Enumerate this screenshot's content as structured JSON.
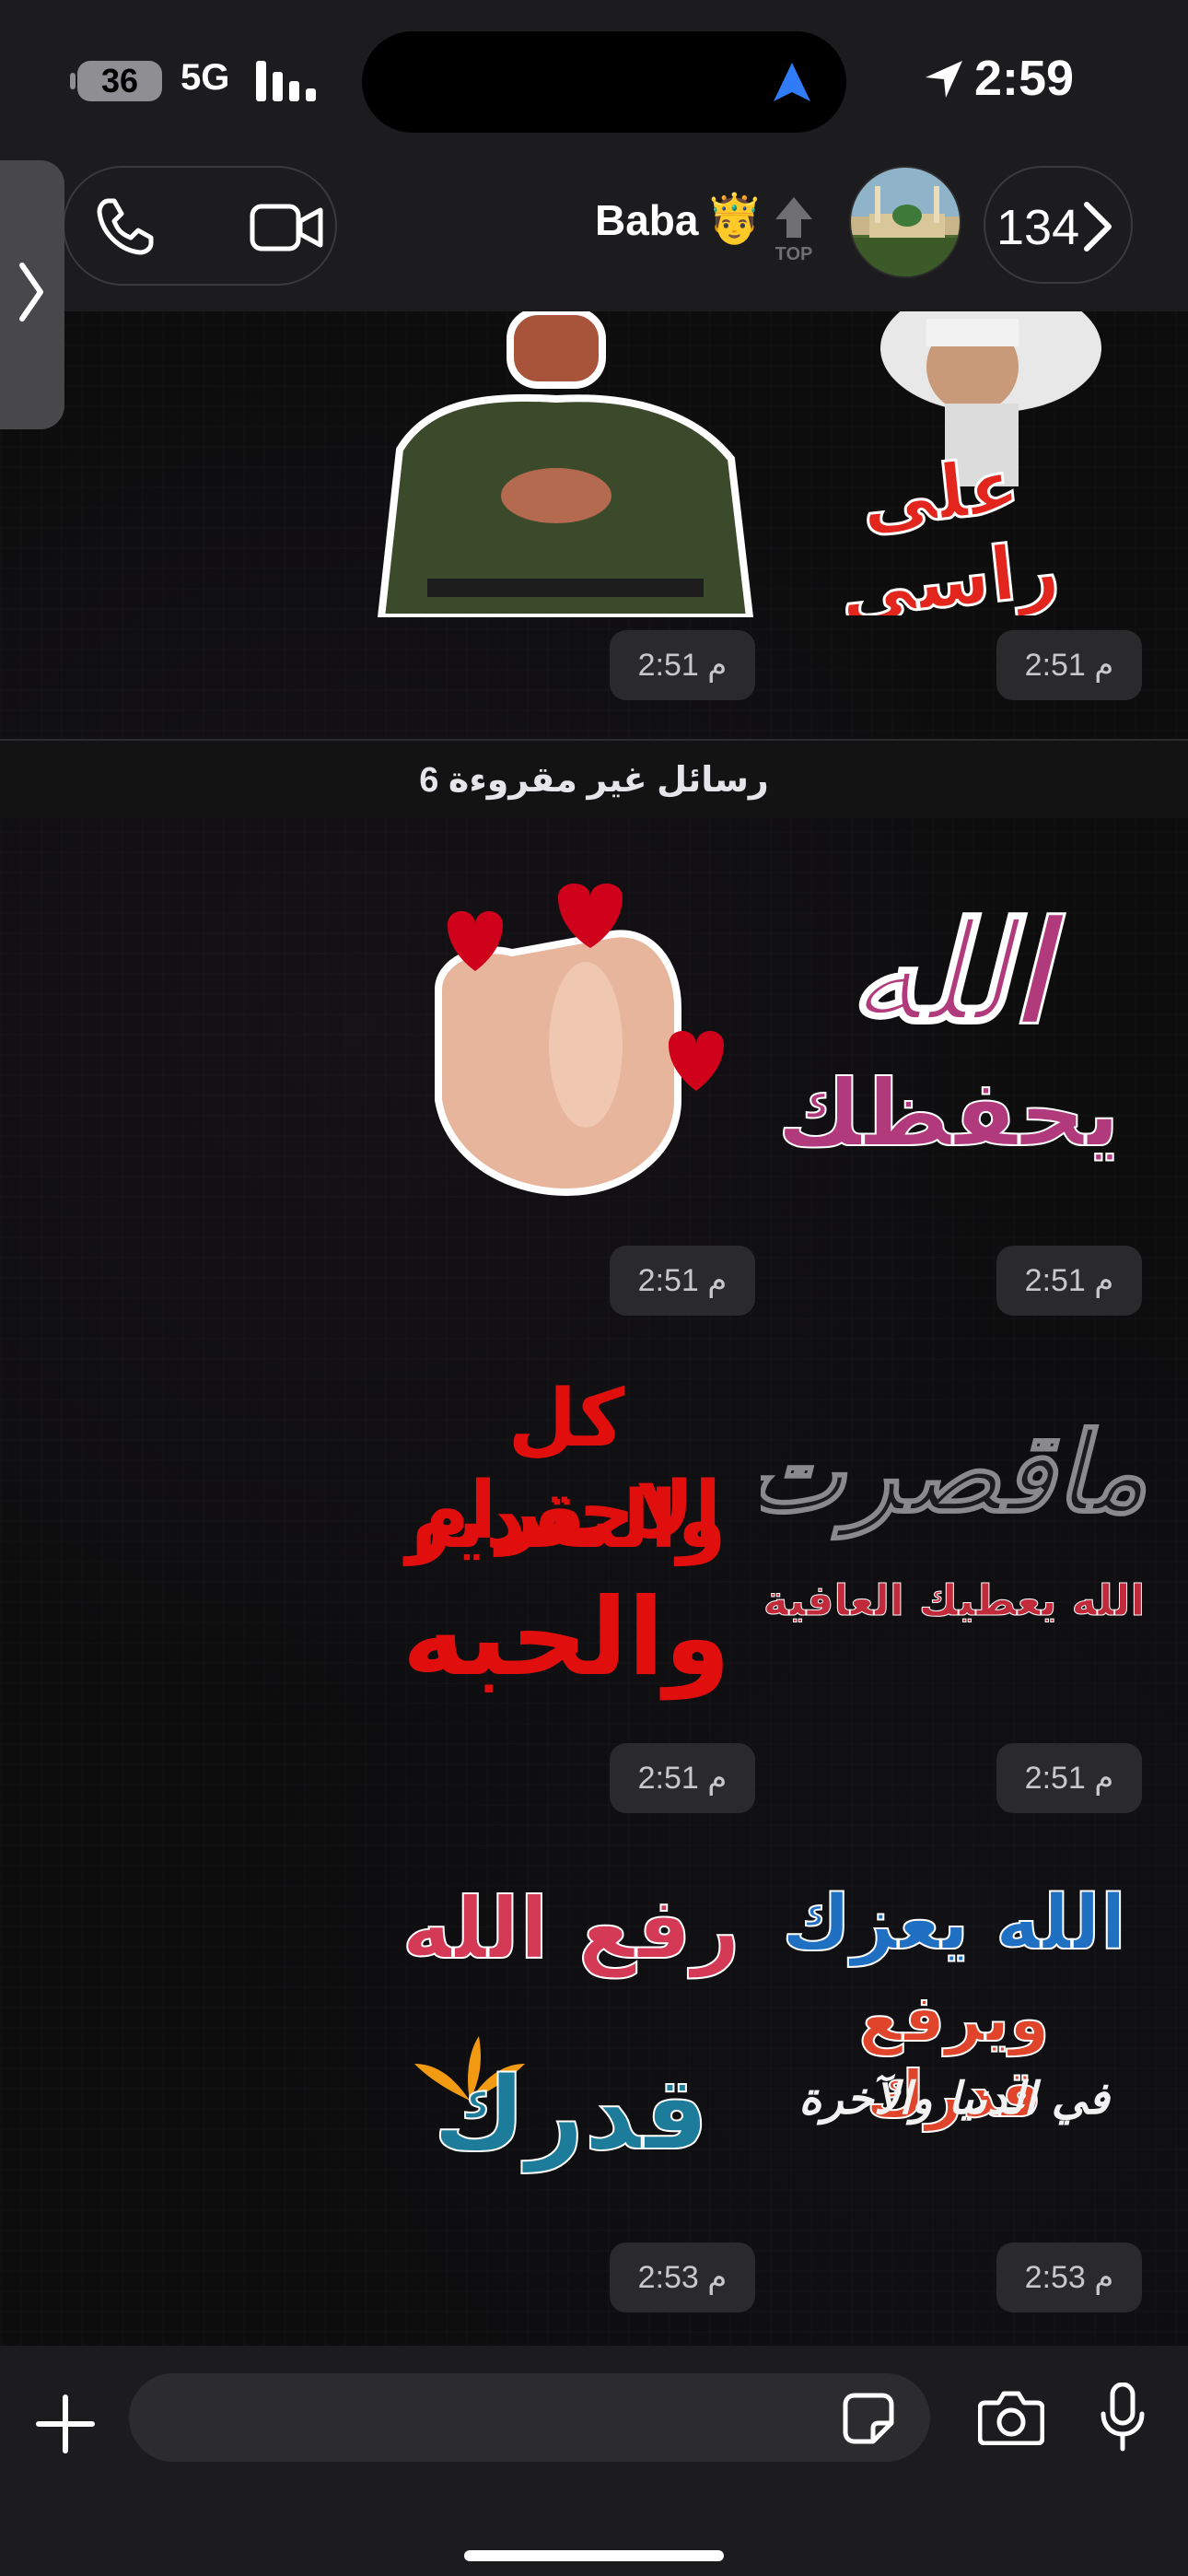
{
  "status_bar": {
    "battery_level": "36",
    "network": "5G",
    "time": "2:59"
  },
  "header": {
    "contact_name": "Baba",
    "contact_emoji": "🤴",
    "top_badge_label": "TOP",
    "back_count": "134",
    "icons": [
      "phone-icon",
      "video-camera-icon",
      "chevron-right-icon",
      "chevron-left-icon"
    ]
  },
  "chat": {
    "unread_divider": "6 رسائل غير مقروءة",
    "stickers": [
      {
        "caption": "على راسي",
        "time": "2:51 م"
      },
      {
        "caption": "",
        "time": "2:51 م"
      },
      {
        "caption_line1": "الله",
        "caption_line2": "يحفظك",
        "time": "2:51 م"
      },
      {
        "caption": "",
        "time": "2:51 م"
      },
      {
        "caption_line1": "ماقصرت",
        "caption_line2": "الله يعطيك العافية",
        "time": "2:51 م"
      },
      {
        "caption_line1": "كل الاحترام",
        "caption_line2": "والتقدير",
        "caption_line3": "والحبه",
        "time": "2:51 م"
      },
      {
        "caption_line1": "الله يعزك",
        "caption_line2": "ويرفع قدرك",
        "caption_line3": "في الدنيا والآخرة",
        "time": "2:53 م"
      },
      {
        "caption_line1": "رفع الله",
        "caption_line2": "قدرك",
        "time": "2:53 م"
      }
    ]
  },
  "input_bar": {
    "placeholder": "",
    "icons": [
      "plus-icon",
      "sticker-icon",
      "camera-icon",
      "microphone-icon"
    ]
  },
  "colors": {
    "bar_bg": "#1c1c1e",
    "timestamp_bg": "#2a2a2c",
    "accent_blue": "#0a84ff",
    "heart_red": "#d0021b"
  }
}
